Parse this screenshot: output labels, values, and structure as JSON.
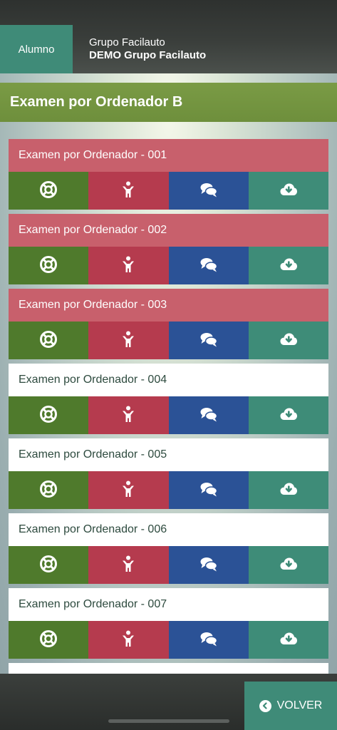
{
  "header": {
    "tab_label": "Alumno",
    "group_label": "Grupo Facilauto",
    "group_name": "DEMO Grupo Facilauto"
  },
  "page_title": "Examen por Ordenador B",
  "exams": [
    {
      "title": "Examen por Ordenador - 001",
      "status": "failed"
    },
    {
      "title": "Examen por Ordenador - 002",
      "status": "failed"
    },
    {
      "title": "Examen por Ordenador - 003",
      "status": "failed"
    },
    {
      "title": "Examen por Ordenador - 004",
      "status": "pending"
    },
    {
      "title": "Examen por Ordenador - 005",
      "status": "pending"
    },
    {
      "title": "Examen por Ordenador - 006",
      "status": "pending"
    },
    {
      "title": "Examen por Ordenador - 007",
      "status": "pending"
    }
  ],
  "actions": [
    {
      "icon": "lifebuoy-icon",
      "color": "#4f7a2c"
    },
    {
      "icon": "person-icon",
      "color": "#b53b4e"
    },
    {
      "icon": "chat-bubbles-icon",
      "color": "#2b5296"
    },
    {
      "icon": "cloud-download-icon",
      "color": "#3e8c78"
    }
  ],
  "colors": {
    "failed_header": "#c8606c",
    "pending_header": "#ffffff",
    "title_bar": "#6e8f3c",
    "accent": "#3f8b78"
  },
  "footer": {
    "back_label": "VOLVER"
  }
}
